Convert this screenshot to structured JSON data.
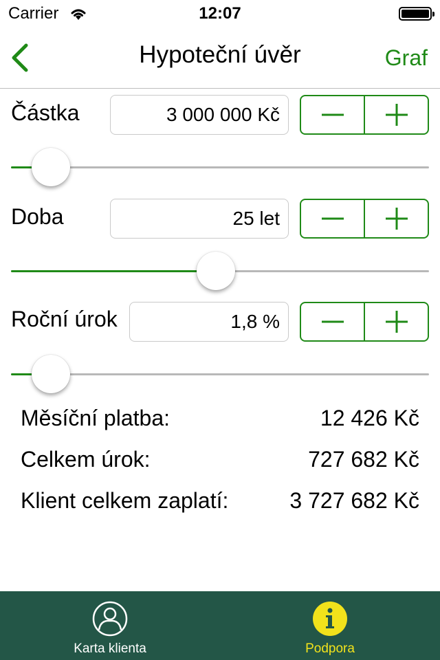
{
  "status_bar": {
    "carrier": "Carrier",
    "time": "12:07"
  },
  "nav": {
    "title": "Hypoteční úvěr",
    "right_button": "Graf"
  },
  "inputs": [
    {
      "label": "Částka",
      "value": "3 000 000 Kč",
      "slider_fraction": 0.095
    },
    {
      "label": "Doba",
      "value": "25 let",
      "slider_fraction": 0.49
    },
    {
      "label": "Roční úrok",
      "value": "1,8 %",
      "slider_fraction": 0.095
    }
  ],
  "results": [
    {
      "label": "Měsíční platba:",
      "value": "12 426 Kč"
    },
    {
      "label": "Celkem úrok:",
      "value": "727 682 Kč"
    },
    {
      "label": "Klient celkem zaplatí:",
      "value": "3 727 682 Kč"
    }
  ],
  "tabs": [
    {
      "label": "Karta klienta",
      "icon": "person-circle-icon",
      "color": "#ffffff"
    },
    {
      "label": "Podpora",
      "icon": "info-icon",
      "color": "#f2e21b",
      "active": true
    }
  ],
  "colors": {
    "accent": "#1f8a17",
    "tab_bar": "#235647",
    "active_tab": "#f2e21b"
  }
}
